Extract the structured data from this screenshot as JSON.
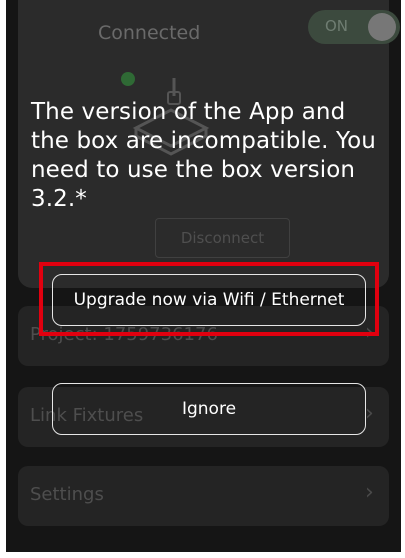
{
  "background": {
    "status_text": "Connected",
    "toggle_label": "ON",
    "disconnect_label": "Disconnect",
    "rows": [
      {
        "label": "Project: 1759736176"
      },
      {
        "label": "Link Fixtures"
      },
      {
        "label": "Settings"
      }
    ]
  },
  "dialog": {
    "message": "The version of the App and the box are incompatible. You need to use the box version 3.2.*",
    "upgrade_label": "Upgrade now via Wifi / Ethernet",
    "ignore_label": "Ignore"
  },
  "colors": {
    "highlight": "#e1000f",
    "background": "#151515",
    "text": "#ffffff"
  }
}
